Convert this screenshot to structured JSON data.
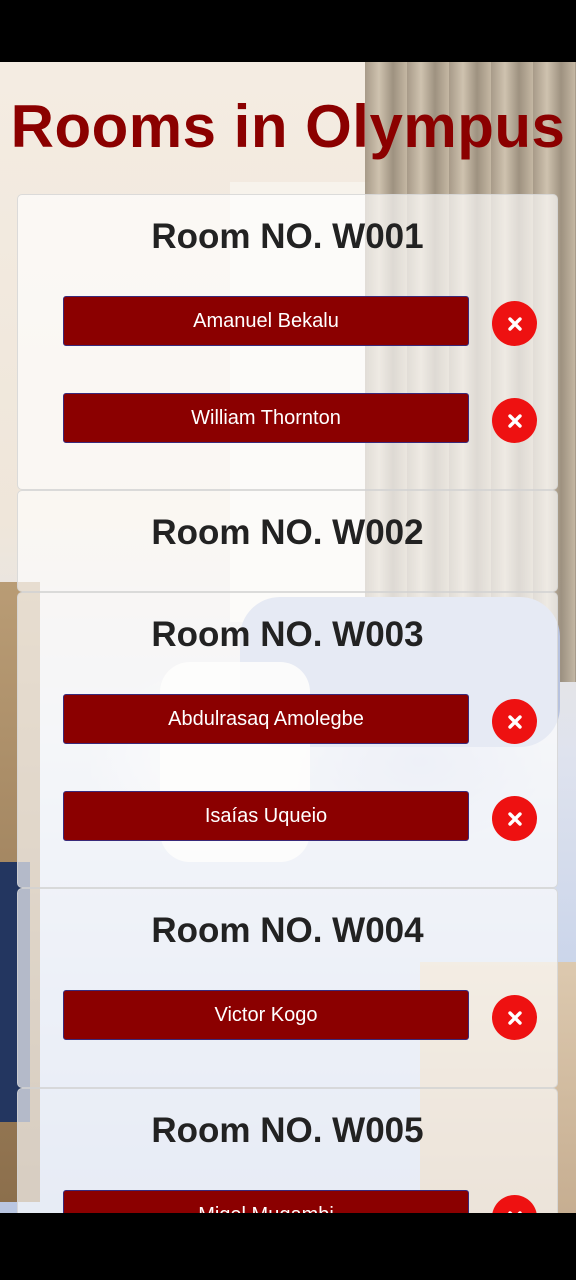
{
  "page": {
    "title": "Rooms in Olympus"
  },
  "colors": {
    "accent": "#8b0000",
    "remove": "#ee1111"
  },
  "rooms": [
    {
      "label": "Room NO. W001",
      "guests": [
        {
          "name": "Amanuel Bekalu",
          "remove_icon": "close-icon"
        },
        {
          "name": "William Thornton",
          "remove_icon": "close-icon"
        }
      ]
    },
    {
      "label": "Room NO. W002",
      "guests": []
    },
    {
      "label": "Room NO. W003",
      "guests": [
        {
          "name": "Abdulrasaq Amolegbe",
          "remove_icon": "close-icon"
        },
        {
          "name": "Isaías Uqueio",
          "remove_icon": "close-icon"
        }
      ]
    },
    {
      "label": "Room NO. W004",
      "guests": [
        {
          "name": "Victor Kogo",
          "remove_icon": "close-icon"
        }
      ]
    },
    {
      "label": "Room NO. W005",
      "guests": [
        {
          "name": "Migel Mugambi",
          "remove_icon": "close-icon"
        }
      ]
    }
  ]
}
